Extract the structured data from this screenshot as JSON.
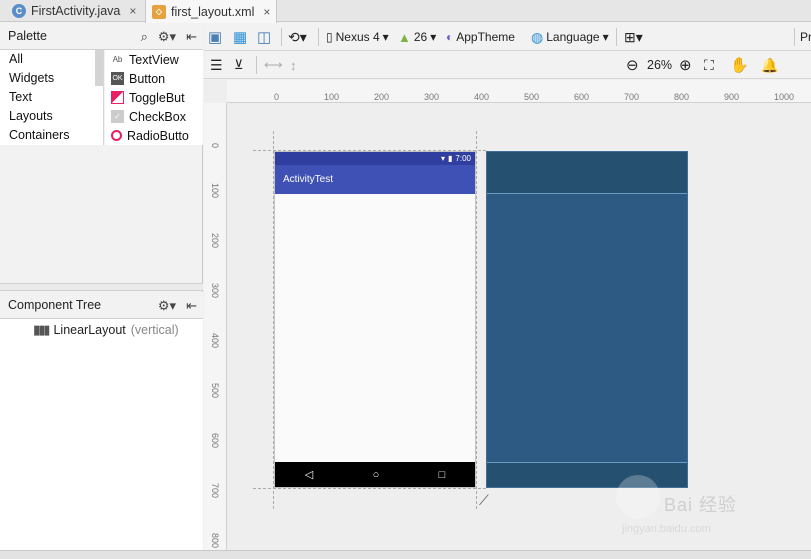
{
  "tabs": [
    {
      "label": "FirstActivity.java",
      "icon": "java-class-icon",
      "active": false
    },
    {
      "label": "first_layout.xml",
      "icon": "xml-layout-icon",
      "active": true
    }
  ],
  "palette": {
    "title": "Palette",
    "categories": [
      "All",
      "Widgets",
      "Text",
      "Layouts",
      "Containers"
    ],
    "widgets": [
      {
        "label": "TextView",
        "icon": "Ab"
      },
      {
        "label": "Button",
        "icon": "OK"
      },
      {
        "label": "ToggleBut",
        "icon": "toggle"
      },
      {
        "label": "CheckBox",
        "icon": "check"
      },
      {
        "label": "RadioButto",
        "icon": "radio"
      }
    ]
  },
  "component_tree": {
    "title": "Component Tree",
    "root_label": "LinearLayout",
    "root_hint": "(vertical)"
  },
  "toolbar": {
    "device": "Nexus 4",
    "api": "26",
    "theme": "AppTheme",
    "language": "Language",
    "zoom": "26%",
    "right_label": "Pr"
  },
  "ruler": {
    "top_ticks": [
      "0",
      "100",
      "200",
      "300",
      "400",
      "500",
      "600",
      "700",
      "800",
      "900",
      "1000"
    ],
    "left_ticks": [
      "0",
      "100",
      "200",
      "300",
      "400",
      "500",
      "600",
      "700",
      "800"
    ]
  },
  "preview": {
    "status_time": "7:00",
    "app_title": "ActivityTest",
    "nav": [
      "◁",
      "○",
      "□"
    ]
  },
  "watermark": {
    "brand": "Bai 经验",
    "url": "jingyan.baidu.com"
  },
  "colors": {
    "status_bar": "#303f9f",
    "app_bar": "#3f51b5",
    "blueprint": "#2d5a82"
  }
}
